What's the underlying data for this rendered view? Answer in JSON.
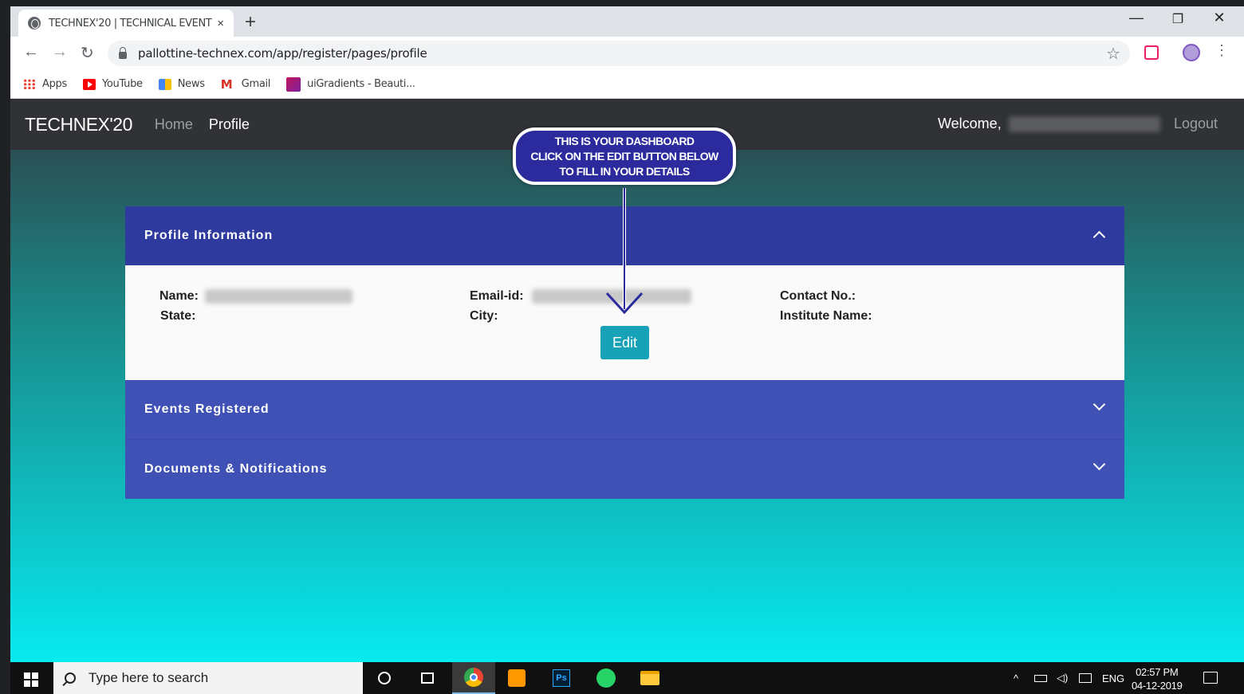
{
  "browser": {
    "tab_title": "TECHNEX'20 | TECHNICAL EVENT",
    "tab_close": "×",
    "new_tab": "+",
    "url": "pallottine-technex.com/app/register/pages/profile",
    "window_controls": {
      "minimize": "—",
      "restore": "❐",
      "close": "✕"
    },
    "nav": {
      "back": "←",
      "forward": "→",
      "reload": "↻"
    },
    "star": "☆",
    "menu": "⋮",
    "bookmarks": [
      {
        "label": "Apps",
        "icon": "apps-grid-icon"
      },
      {
        "label": "YouTube",
        "icon": "youtube-icon"
      },
      {
        "label": "News",
        "icon": "news-icon"
      },
      {
        "label": "Gmail",
        "icon": "gmail-icon"
      },
      {
        "label": "uiGradients - Beauti...",
        "icon": "uigradients-icon"
      }
    ]
  },
  "site": {
    "brand": "TECHNEX'20",
    "nav": {
      "home": "Home",
      "profile": "Profile"
    },
    "welcome": "Welcome,",
    "logout": "Logout",
    "callout": {
      "line1": "THIS IS YOUR DASHBOARD",
      "line2": "CLICK ON THE EDIT BUTTON BELOW",
      "line3": "TO FILL IN YOUR DETAILS"
    },
    "profile_panel": {
      "title": "Profile Information",
      "fields": {
        "name": "Name:",
        "state": "State:",
        "email": "Email-id:",
        "city": "City:",
        "contact": "Contact No.:",
        "institute": "Institute Name:"
      },
      "edit_label": "Edit"
    },
    "events_panel": {
      "title": "Events Registered"
    },
    "docs_panel": {
      "title": "Documents & Notifications"
    }
  },
  "taskbar": {
    "search_placeholder": "Type here to search",
    "tray_lang": "ENG",
    "clock_time": "02:57 PM",
    "clock_date": "04-12-2019"
  },
  "colors": {
    "nav_bg": "#303236",
    "panel_header_dark": "#2e3a9e",
    "panel_header": "#3f51b5",
    "edit_button": "#17a2b8",
    "callout_bg": "#2b2b9e"
  }
}
